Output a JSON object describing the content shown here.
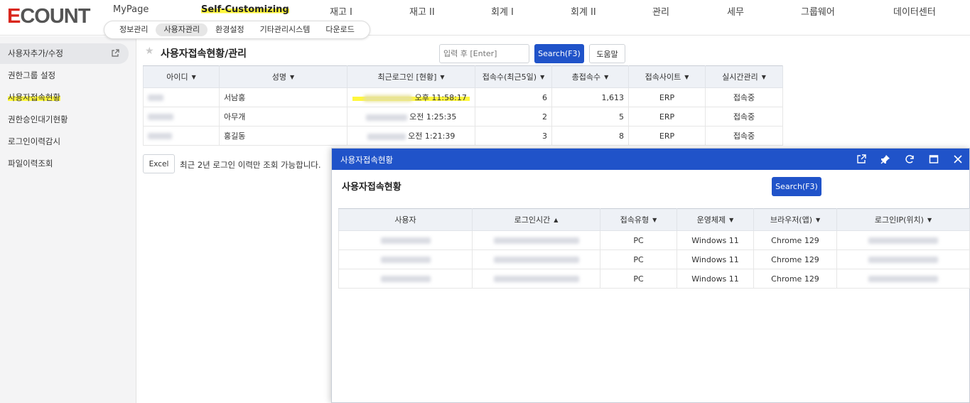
{
  "header": {
    "logo_e": "E",
    "logo_rest": "COUNT",
    "nav": [
      "MyPage",
      "Self-Customizing",
      "재고 I",
      "재고 II",
      "회계 I",
      "회계 II",
      "관리",
      "세무",
      "그룹웨어",
      "데이터센터"
    ],
    "subnav": [
      "정보관리",
      "사용자관리",
      "환경설정",
      "기타관리시스템",
      "다운로드"
    ]
  },
  "sidebar": {
    "items": [
      "사용자추가/수정",
      "권한그룹 설정",
      "사용자접속현황",
      "권한승인대기현황",
      "로그인이력감시",
      "파일이력조회"
    ]
  },
  "main": {
    "title": "사용자접속현황/관리",
    "search_placeholder": "입력 후 [Enter]",
    "search_label": "Search(F3)",
    "help_label": "도움말",
    "columns": [
      "아이디",
      "성명",
      "최근로그인 [현황]",
      "접속수(최근5일)",
      "총접속수",
      "접속사이트",
      "실시간관리"
    ],
    "rows": [
      {
        "name": "서남홍",
        "last_login": "오후 11:58:17",
        "recent": "6",
        "total": "1,613",
        "site": "ERP",
        "status": "접속중"
      },
      {
        "name": "아무개",
        "last_login": "오전 1:25:35",
        "recent": "2",
        "total": "5",
        "site": "ERP",
        "status": "접속중"
      },
      {
        "name": "홍길동",
        "last_login": "오전 1:21:39",
        "recent": "3",
        "total": "8",
        "site": "ERP",
        "status": "접속중"
      }
    ],
    "excel_label": "Excel",
    "note": "최근 2년 로그인 이력만 조회 가능합니다."
  },
  "popup": {
    "window_title": "사용자접속현황",
    "title": "사용자접속현황",
    "search_label": "Search(F3)",
    "columns": [
      "사용자",
      "로그인시간",
      "접속유형",
      "운영체제",
      "브라우저(앱)",
      "로그인IP(위치)"
    ],
    "rows": [
      {
        "type": "PC",
        "os": "Windows 11",
        "browser": "Chrome 129"
      },
      {
        "type": "PC",
        "os": "Windows 11",
        "browser": "Chrome 129"
      },
      {
        "type": "PC",
        "os": "Windows 11",
        "browser": "Chrome 129"
      }
    ]
  },
  "colors": {
    "primary": "#2053c9",
    "highlight": "#fff73d",
    "logo_red": "#d9261c"
  }
}
